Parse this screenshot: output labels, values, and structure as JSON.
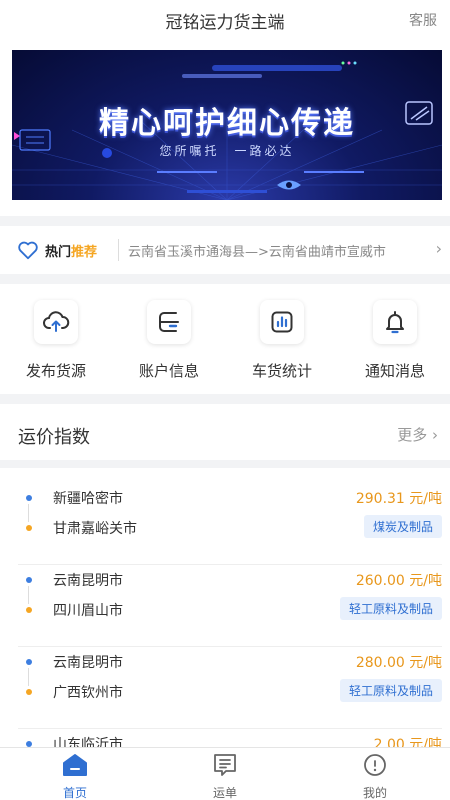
{
  "header": {
    "title": "冠铭运力货主端",
    "service_label": "客服"
  },
  "banner": {
    "headline": "精心呵护细心传递",
    "subtitle": "您所嘱托　一路必达"
  },
  "hot": {
    "label_prefix": "热门",
    "label_suffix": "推荐",
    "route": "云南省玉溪市通海县—>云南省曲靖市宣威市",
    "arrow": "›"
  },
  "menu": [
    {
      "label": "发布货源",
      "icon": "cloud-upload-icon"
    },
    {
      "label": "账户信息",
      "icon": "wallet-icon"
    },
    {
      "label": "车货统计",
      "icon": "bar-chart-icon"
    },
    {
      "label": "通知消息",
      "icon": "bell-icon"
    }
  ],
  "price_index": {
    "title": "运价指数",
    "more_label": "更多 ›",
    "rows": [
      {
        "from": "新疆哈密市",
        "to": "甘肃嘉峪关市",
        "price": "290.31 元/吨",
        "tag": "煤炭及制品"
      },
      {
        "from": "云南昆明市",
        "to": "四川眉山市",
        "price": "260.00 元/吨",
        "tag": "轻工原料及制品"
      },
      {
        "from": "云南昆明市",
        "to": "广西钦州市",
        "price": "280.00 元/吨",
        "tag": "轻工原料及制品"
      },
      {
        "from": "山东临沂市",
        "to": "",
        "price": "2.00 元/吨",
        "tag": ""
      }
    ]
  },
  "tabbar": [
    {
      "label": "首页",
      "icon": "home-icon",
      "active": true
    },
    {
      "label": "运单",
      "icon": "waybill-icon",
      "active": false
    },
    {
      "label": "我的",
      "icon": "profile-icon",
      "active": false
    }
  ],
  "colors": {
    "accent": "#2f6fd1",
    "price": "#e8971c",
    "hot": "#f5a623"
  }
}
